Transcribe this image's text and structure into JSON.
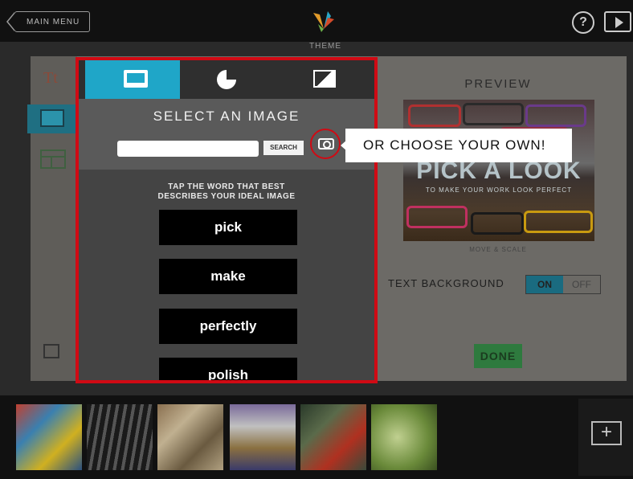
{
  "header": {
    "main_menu_label": "MAIN MENU",
    "theme_label": "THEME",
    "help_glyph": "?"
  },
  "modal": {
    "tabs": [
      "image-tab",
      "chart-tab",
      "contrast-tab"
    ],
    "title": "SELECT AN IMAGE",
    "search_button": "SEARCH",
    "search_value": "",
    "tap_line1": "TAP THE WORD THAT BEST",
    "tap_line2": "DESCRIBES YOUR IDEAL IMAGE",
    "words": [
      "pick",
      "make",
      "perfectly",
      "polish"
    ],
    "callout": "OR CHOOSE YOUR OWN!"
  },
  "preview": {
    "label": "PREVIEW",
    "headline": "PICK A LOOK",
    "subline": "TO MAKE YOUR WORK LOOK PERFECT",
    "move_scale": "MOVE & SCALE",
    "text_background_label": "TEXT BACKGROUND",
    "toggle_on": "ON",
    "toggle_off": "OFF",
    "done": "DONE"
  },
  "sidebar": {
    "text_tool": "Tt"
  },
  "bottom": {
    "add_glyph": "+"
  },
  "colors": {
    "modal_border": "#d00a14",
    "active_tab": "#1fa6c8",
    "done": "#2e7a3e"
  }
}
